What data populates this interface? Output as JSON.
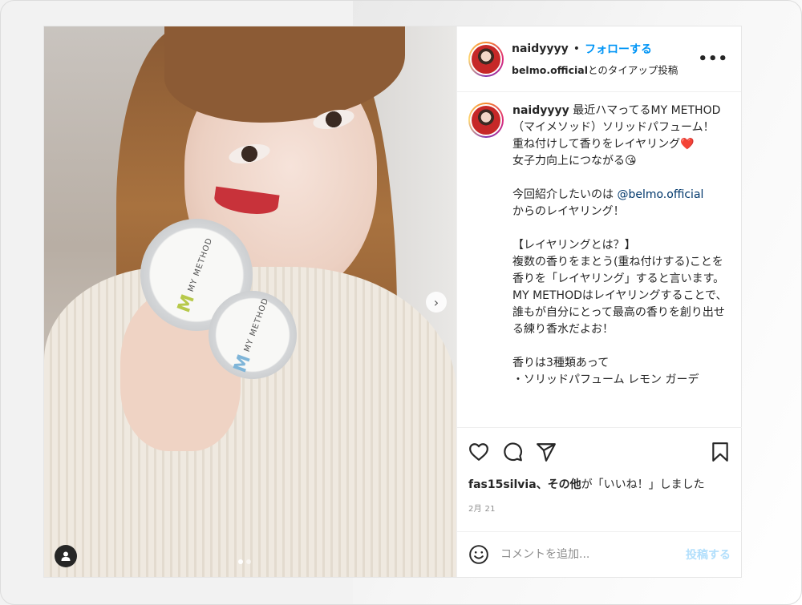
{
  "header": {
    "username": "naidyyyy",
    "separator": "•",
    "follow_label": "フォローする",
    "partner_account": "belmo.official",
    "partner_suffix": "とのタイアップ投稿",
    "more_label": "•••"
  },
  "media": {
    "tin_brand": "MY METHOD",
    "next_label": "›",
    "slide_count": 2,
    "active_slide": 1
  },
  "caption": {
    "username": "naidyyyy",
    "part1": " 最近ハマってるMY METHOD（マイメソッド）ソリッドパフューム！\n重ね付けして香りをレイヤリング❤️\n女子力向上につながる😘\n\n今回紹介したいのは ",
    "mention": "@belmo.official",
    "part2": "\nからのレイヤリング！\n\n【レイヤリングとは？】\n複数の香りをまとう(重ね付けする)ことを香りを「レイヤリング」すると言います。\nMY METHODはレイヤリングすることで、誰もが自分にとって最高の香りを創り出せる練り香水だよお！\n\n香りは3種類あって\n・ソリッドパフューム レモン ガーデ"
  },
  "actions": {
    "like_icon": "heart-icon",
    "comment_icon": "comment-icon",
    "share_icon": "paper-plane-icon",
    "save_icon": "bookmark-icon"
  },
  "likes": {
    "user": "fas15silvia",
    "others": "、その他",
    "suffix": "が「いいね！」しました"
  },
  "date": "2月 21",
  "comment": {
    "placeholder": "コメントを追加...",
    "post_label": "投稿する"
  },
  "colors": {
    "accent": "#0095f6",
    "post_disabled": "#b2dffc",
    "mention": "#00376b"
  }
}
